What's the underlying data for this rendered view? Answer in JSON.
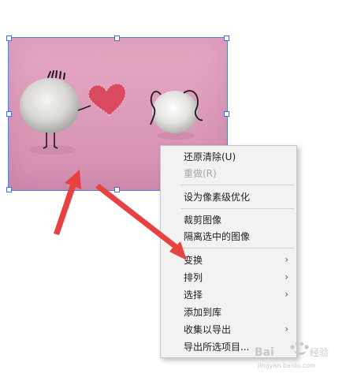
{
  "context_menu": {
    "items": [
      {
        "label": "还原清除(U)",
        "enabled": true,
        "submenu": false
      },
      {
        "label": "重做(R)",
        "enabled": false,
        "submenu": false
      },
      {
        "label": "设为像素级优化",
        "enabled": true,
        "submenu": false
      },
      {
        "label": "裁剪图像",
        "enabled": true,
        "submenu": false
      },
      {
        "label": "隔离选中的图像",
        "enabled": true,
        "submenu": false
      },
      {
        "label": "变换",
        "enabled": true,
        "submenu": true
      },
      {
        "label": "排列",
        "enabled": true,
        "submenu": true
      },
      {
        "label": "选择",
        "enabled": true,
        "submenu": true
      },
      {
        "label": "添加到库",
        "enabled": true,
        "submenu": false
      },
      {
        "label": "收集以导出",
        "enabled": true,
        "submenu": true
      },
      {
        "label": "导出所选项目...",
        "enabled": true,
        "submenu": false
      }
    ],
    "submenu_arrow": "›"
  },
  "image": {
    "subject": "two-pebble-figures-with-heart",
    "background_color": "#e2a3c1"
  },
  "annotation": {
    "arrow_color": "#e8413f"
  },
  "watermark": {
    "text": "Baidu 经验",
    "subtext": "jingyan.baidu.com"
  }
}
